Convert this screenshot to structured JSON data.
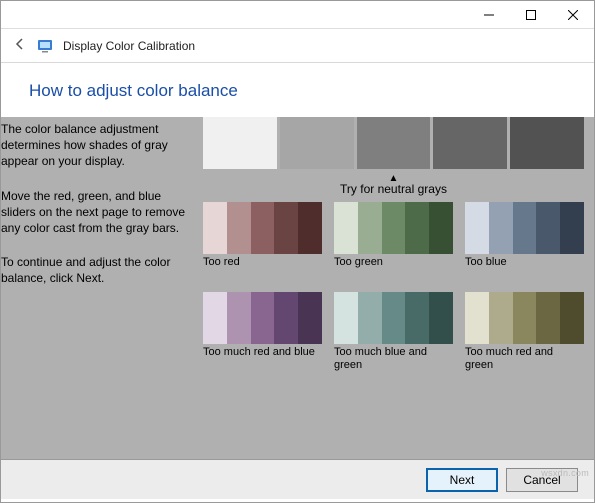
{
  "window": {
    "app_title": "Display Color Calibration",
    "heading": "How to adjust color balance"
  },
  "text": {
    "p1": "The color balance adjustment determines how shades of gray appear on your display.",
    "p2": "Move the red, green, and blue sliders on the next page to remove any color cast from the gray bars.",
    "p3": "To continue and adjust the color balance, click Next."
  },
  "top_swatches": [
    "#f0f0f0",
    "#a6a6a6",
    "#7f7f7f",
    "#666666",
    "#525252"
  ],
  "try_label": "Try for neutral grays",
  "samples": [
    {
      "label": "Too red",
      "bars": [
        "#e6d6d6",
        "#b39090",
        "#8c6060",
        "#6a4343",
        "#4f2d2d"
      ]
    },
    {
      "label": "Too green",
      "bars": [
        "#d9e2d4",
        "#99ad93",
        "#6d8a66",
        "#4e6b49",
        "#374f33"
      ]
    },
    {
      "label": "Too blue",
      "bars": [
        "#d4dbe4",
        "#93a1b3",
        "#66788c",
        "#49596b",
        "#333f4f"
      ]
    },
    {
      "label": "Too much red and blue",
      "bars": [
        "#e2d7e4",
        "#ad93b0",
        "#886690",
        "#634770",
        "#493454"
      ]
    },
    {
      "label": "Too much blue and green",
      "bars": [
        "#d4e2e0",
        "#93adab",
        "#668a87",
        "#496b67",
        "#334f4c"
      ]
    },
    {
      "label": "Too much red and green",
      "bars": [
        "#e2e0ce",
        "#adab8c",
        "#8a875e",
        "#6b6742",
        "#4f4c2e"
      ]
    }
  ],
  "footer": {
    "next": "Next",
    "cancel": "Cancel"
  },
  "watermark": "wsxdn.com"
}
